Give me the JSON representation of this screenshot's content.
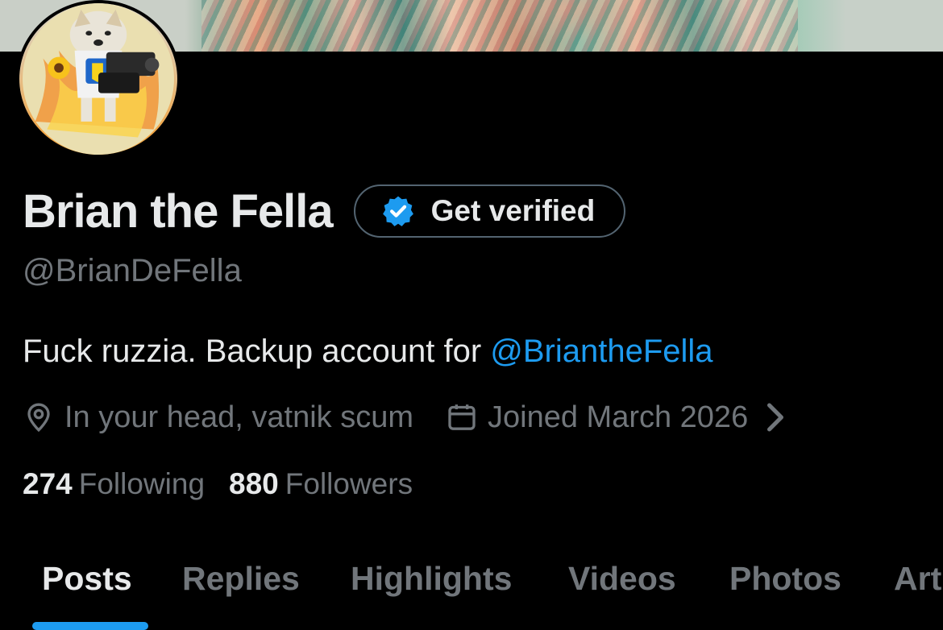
{
  "profile": {
    "display_name": "Brian the Fella",
    "handle": "@BrianDeFella",
    "verify_button_label": "Get verified",
    "bio": {
      "text": "Fuck ruzzia. Backup account for ",
      "mention": "@BriantheFella"
    },
    "location": "In your head, vatnik scum",
    "joined": "Joined March 2026",
    "following_count": "274",
    "following_label": "Following",
    "followers_count": "880",
    "followers_label": "Followers"
  },
  "tabs": [
    {
      "label": "Posts",
      "active": true
    },
    {
      "label": "Replies",
      "active": false
    },
    {
      "label": "Highlights",
      "active": false
    },
    {
      "label": "Videos",
      "active": false
    },
    {
      "label": "Photos",
      "active": false
    },
    {
      "label": "Art",
      "active": false
    }
  ],
  "icons": {
    "verified": "verified-badge-icon",
    "location": "location-pin-icon",
    "calendar": "calendar-icon",
    "chevron": "chevron-right-icon"
  },
  "colors": {
    "background": "#000000",
    "text_primary": "#e7e9ea",
    "text_secondary": "#71767b",
    "accent": "#1d9bf0",
    "button_border": "#536471"
  }
}
